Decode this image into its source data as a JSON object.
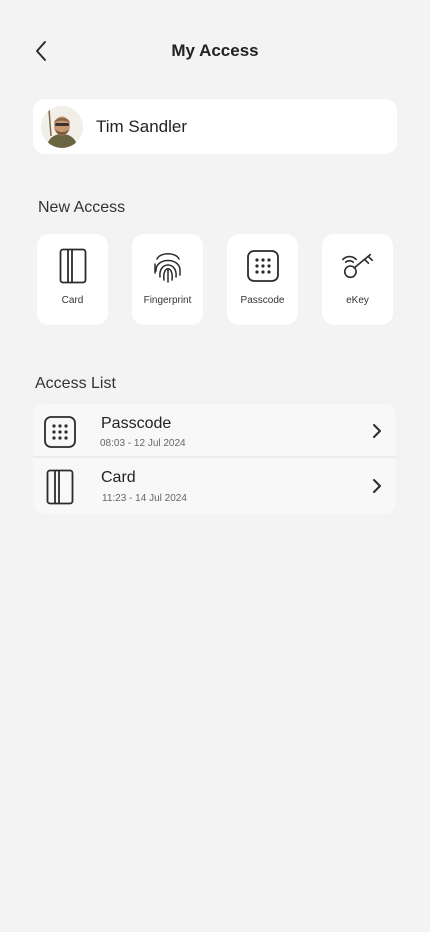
{
  "header": {
    "title": "My Access",
    "back_icon": "chevron-left-icon"
  },
  "user": {
    "name": "Tim Sandler",
    "avatar_icon": "user-avatar"
  },
  "new_access": {
    "title": "New Access",
    "tiles": [
      {
        "label": "Card",
        "icon": "card-icon"
      },
      {
        "label": "Fingerprint",
        "icon": "fingerprint-icon"
      },
      {
        "label": "Passcode",
        "icon": "keypad-icon"
      },
      {
        "label": "eKey",
        "icon": "ekey-icon"
      }
    ]
  },
  "access_list": {
    "title": "Access List",
    "items": [
      {
        "title": "Passcode",
        "subtitle": "08:03 - 12 Jul 2024",
        "icon": "keypad-icon"
      },
      {
        "title": "Card",
        "subtitle": "11:23 - 14 Jul 2024",
        "icon": "card-icon"
      }
    ]
  },
  "colors": {
    "background": "#f3f3f3",
    "card": "#ffffff",
    "text": "#222222",
    "icon_stroke": "#2b2b2b"
  }
}
